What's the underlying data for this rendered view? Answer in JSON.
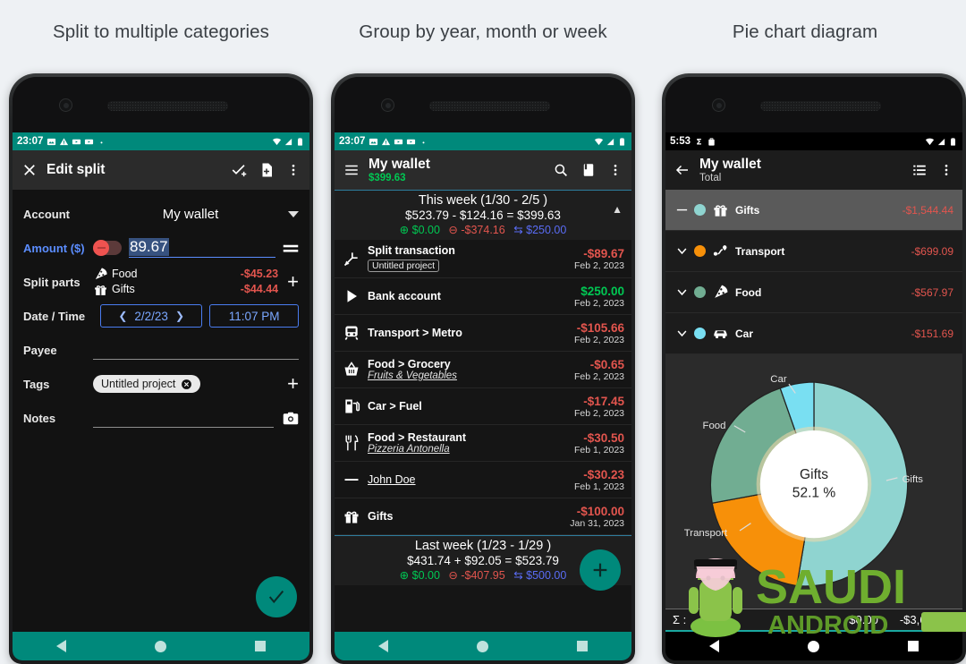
{
  "panels": [
    {
      "caption": "Split to multiple categories"
    },
    {
      "caption": "Group by year, month or week"
    },
    {
      "caption": "Pie chart diagram"
    }
  ],
  "phone1": {
    "status": {
      "time": "23:07",
      "icons": [
        "image-icon",
        "warning-icon",
        "video-icon",
        "video-icon",
        "dot-icon"
      ],
      "right": [
        "wifi-icon",
        "signal-icon",
        "battery-icon"
      ]
    },
    "appbar": {
      "close": "close-icon",
      "title": "Edit split",
      "action1": "check-add-icon",
      "action2": "file-add-icon",
      "action3": "overflow-icon"
    },
    "fields": {
      "account_label": "Account",
      "account_value": "My wallet",
      "amount_label": "Amount ($)",
      "amount_value": "89.67",
      "splitparts_label": "Split parts",
      "splitparts": [
        {
          "icon": "pizza-icon",
          "name": "Food",
          "amount": "-$45.23"
        },
        {
          "icon": "gift-icon",
          "name": "Gifts",
          "amount": "-$44.44"
        }
      ],
      "datetime_label": "Date / Time",
      "date_value": "2/2/23",
      "time_value": "11:07 PM",
      "payee_label": "Payee",
      "payee_value": "",
      "tags_label": "Tags",
      "tag_chip": "Untitled project",
      "notes_label": "Notes",
      "notes_value": ""
    },
    "fab": "check-icon",
    "nav": [
      "back-triangle-icon",
      "home-circle-icon",
      "recents-square-icon"
    ]
  },
  "phone2": {
    "status": {
      "time": "23:07"
    },
    "appbar": {
      "menu": "hamburger-icon",
      "title": "My wallet",
      "balance": "$399.63",
      "search": "search-icon",
      "book": "book-icon",
      "overflow": "overflow-icon"
    },
    "group_this_week": {
      "title": "This week (1/30 - 2/5 )",
      "sum_prev": "$523.79",
      "sum_op": "-",
      "sum_delta": "$124.16",
      "sum_eq": "=",
      "sum_total": "$399.63",
      "income": "$0.00",
      "expense": "-$374.16",
      "transfer": "$250.00",
      "collapse": "chevron-up-icon"
    },
    "transactions": [
      {
        "icon": "split-icon",
        "title": "Split transaction",
        "sub": "Untitled project",
        "sub_style": "chip",
        "amount": "-$89.67",
        "amount_type": "neg",
        "date": "Feb 2, 2023"
      },
      {
        "icon": "play-icon",
        "title": "Bank account",
        "sub": "",
        "sub_style": "",
        "amount": "$250.00",
        "amount_type": "pos",
        "date": "Feb 2, 2023"
      },
      {
        "icon": "tram-icon",
        "title": "Transport > Metro",
        "sub": "",
        "sub_style": "",
        "amount": "-$105.66",
        "amount_type": "neg",
        "date": "Feb 2, 2023"
      },
      {
        "icon": "basket-icon",
        "title": "Food > Grocery",
        "sub": "Fruits & Vegetables",
        "sub_style": "italic",
        "amount": "-$0.65",
        "amount_type": "neg",
        "date": "Feb 2, 2023"
      },
      {
        "icon": "fuel-icon",
        "title": "Car > Fuel",
        "sub": "",
        "sub_style": "",
        "amount": "-$17.45",
        "amount_type": "neg",
        "date": "Feb 2, 2023"
      },
      {
        "icon": "restaurant-icon",
        "title": "Food > Restaurant",
        "sub": "Pizzeria Antonella",
        "sub_style": "italic",
        "amount": "-$30.50",
        "amount_type": "neg",
        "date": "Feb 1, 2023"
      },
      {
        "icon": "dash-icon",
        "title": "John Doe",
        "title_style": "plain",
        "sub": "",
        "sub_style": "",
        "amount": "-$30.23",
        "amount_type": "neg",
        "date": "Feb 1, 2023"
      },
      {
        "icon": "gift-icon",
        "title": "Gifts",
        "sub": "",
        "sub_style": "",
        "amount": "-$100.00",
        "amount_type": "neg",
        "date": "Jan 31, 2023"
      }
    ],
    "group_last_week": {
      "title": "Last week (1/23 - 1/29 )",
      "sum_prev": "$431.74",
      "sum_op": "+",
      "sum_delta": "$92.05",
      "sum_eq": "=",
      "sum_total": "$523.79",
      "income": "$0.00",
      "expense": "-$407.95",
      "transfer": "$500.00"
    },
    "fab": "plus-icon",
    "nav": [
      "back-triangle-icon",
      "home-circle-icon",
      "recents-square-icon"
    ]
  },
  "phone3": {
    "status": {
      "time": "5:53",
      "icons": [
        "sigma-icon",
        "bag-icon"
      ]
    },
    "appbar": {
      "back": "back-arrow-icon",
      "title": "My wallet",
      "subtitle": "Total",
      "list": "list-icon",
      "overflow": "overflow-icon"
    },
    "categories": [
      {
        "expander": "dash-icon",
        "color": "#8fd4d0",
        "icon": "gift-icon",
        "name": "Gifts",
        "amount": "-$1,544.44",
        "selected": true
      },
      {
        "expander": "chevron-down-icon",
        "color": "#f79009",
        "icon": "route-icon",
        "name": "Transport",
        "amount": "-$699.09",
        "selected": false
      },
      {
        "expander": "chevron-down-icon",
        "color": "#71ad92",
        "icon": "pizza-icon",
        "name": "Food",
        "amount": "-$567.97",
        "selected": false
      },
      {
        "expander": "chevron-down-icon",
        "color": "#79dff2",
        "icon": "car-icon",
        "name": "Car",
        "amount": "-$151.69",
        "selected": false
      }
    ],
    "center_label": "Gifts",
    "center_value": "52.1 %",
    "sum_symbol": "Σ :",
    "sum_income": "$0.00",
    "sum_total": "-$3,685.68",
    "nav": [
      "back-triangle-icon",
      "home-circle-icon",
      "recents-square-icon"
    ]
  },
  "chart_data": {
    "type": "pie",
    "title": "Pie chart diagram",
    "labels": [
      "Gifts",
      "Transport",
      "Food",
      "Car"
    ],
    "values": [
      1544.44,
      699.09,
      567.97,
      151.69
    ],
    "percents": [
      52.1,
      23.6,
      19.2,
      5.1
    ],
    "colors": [
      "#8fd4d0",
      "#f79009",
      "#71ad92",
      "#79dff2"
    ],
    "center_label": "Gifts",
    "center_value": "52.1 %",
    "donut": true,
    "legend": "on-slice-labels",
    "total": "-$3,685.68"
  },
  "watermark": {
    "line1": "SAUDI",
    "line2": "ANDROID"
  }
}
